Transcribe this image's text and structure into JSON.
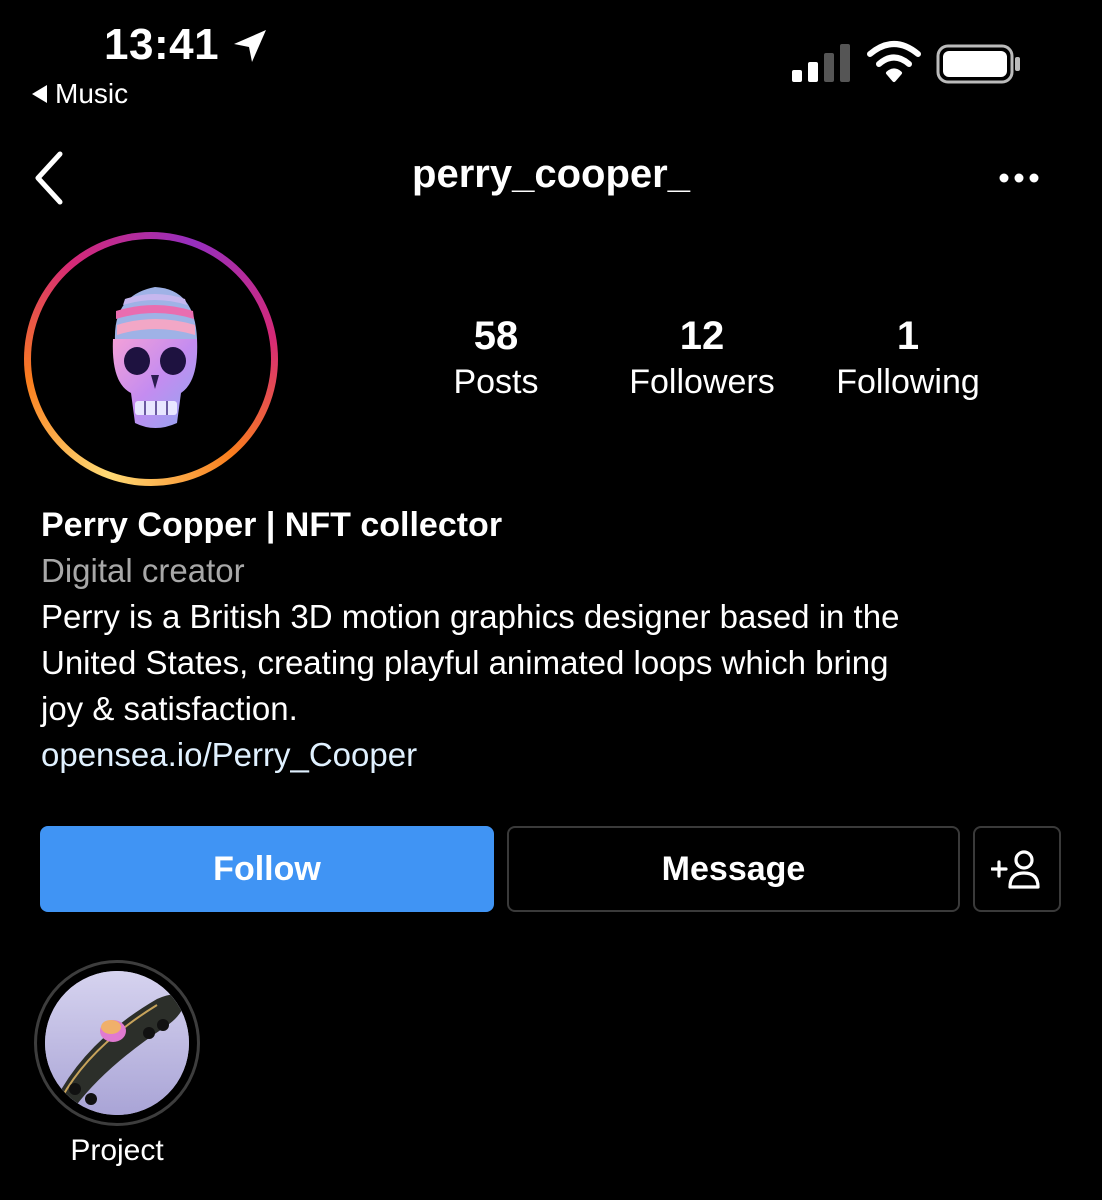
{
  "status_bar": {
    "time": "13:41",
    "back_app": "Music",
    "icons": [
      "location-arrow-icon",
      "signal-icon",
      "wifi-icon",
      "battery-icon"
    ]
  },
  "nav": {
    "username": "perry_cooper_",
    "back_icon": "chevron-left-icon",
    "more_icon": "more-horizontal-icon"
  },
  "profile": {
    "stats": [
      {
        "value": "58",
        "label": "Posts"
      },
      {
        "value": "12",
        "label": "Followers"
      },
      {
        "value": "1",
        "label": "Following"
      }
    ],
    "name": "Perry Copper | NFT collector",
    "category": "Digital creator",
    "bio_lines": [
      "Perry is a British 3D motion graphics designer based in the",
      "United States, creating playful animated loops which bring",
      "joy & satisfaction."
    ],
    "link": "opensea.io/Perry_Cooper"
  },
  "actions": {
    "follow": "Follow",
    "message": "Message",
    "add_icon": "add-person-icon"
  },
  "highlights": [
    {
      "label": "Project"
    }
  ],
  "colors": {
    "background": "#000000",
    "follow_button": "#4094f4",
    "secondary_text": "#a8a8a8",
    "link": "#e0f1ff"
  }
}
